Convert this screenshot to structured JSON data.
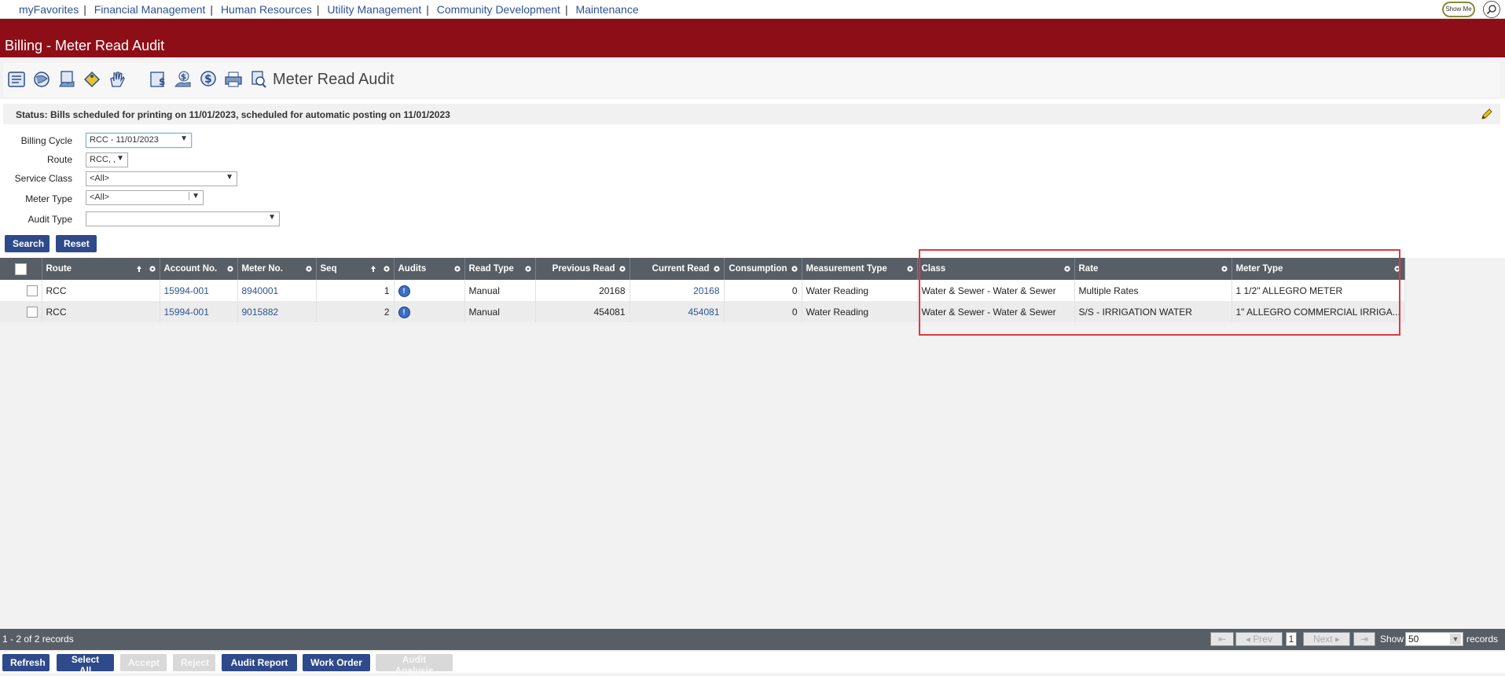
{
  "nav": {
    "links": [
      "myFavorites",
      "Financial Management",
      "Human Resources",
      "Utility Management",
      "Community Development",
      "Maintenance"
    ],
    "show_me": "Show Me"
  },
  "title": "Billing - Meter Read Audit",
  "toolbar": {
    "title": "Meter Read Audit",
    "icons": [
      "billing-list-icon",
      "globe-icon",
      "hand-doc-icon",
      "tag-icon",
      "hand-icon",
      "dollar-doc-icon",
      "dollar-hand-icon",
      "dollar-icon",
      "printer-icon",
      "search-doc-icon"
    ]
  },
  "status": {
    "text": "Status:  Bills scheduled for printing on 11/01/2023, scheduled for automatic posting on 11/01/2023"
  },
  "filters": {
    "billing_cycle_label": "Billing Cycle",
    "billing_cycle_value": "RCC - 11/01/2023",
    "route_label": "Route",
    "route_value": "RCC, ,",
    "service_class_label": "Service Class",
    "service_class_value": "<All>",
    "meter_type_label": "Meter Type",
    "meter_type_value": "<All>",
    "audit_type_label": "Audit Type",
    "audit_type_value": ""
  },
  "buttons": {
    "search": "Search",
    "reset": "Reset"
  },
  "grid": {
    "columns": [
      "Route",
      "Account No.",
      "Meter No.",
      "Seq",
      "Audits",
      "Read Type",
      "Previous Read",
      "Current Read",
      "Consumption",
      "Measurement Type",
      "Class",
      "Rate",
      "Meter Type"
    ],
    "rows": [
      [
        "RCC",
        "15994-001",
        "8940001",
        "1",
        "",
        "Manual",
        "20168",
        "20168",
        "0",
        "Water Reading",
        "Water & Sewer - Water & Sewer",
        "Multiple Rates",
        "1 1/2\" ALLEGRO METER"
      ],
      [
        "RCC",
        "15994-001",
        "9015882",
        "2",
        "",
        "Manual",
        "454081",
        "454081",
        "0",
        "Water Reading",
        "Water & Sewer - Water & Sewer",
        "S/S - IRRIGATION WATER",
        "1\" ALLEGRO COMMERCIAL IRRIGA..."
      ]
    ]
  },
  "footer": {
    "record_count": "1 - 2 of 2 records",
    "prev": "Prev",
    "next": "Next",
    "page": "1",
    "show_label": "Show",
    "show_value": "50",
    "records_label": "records"
  },
  "actions": {
    "refresh": "Refresh",
    "select_all": "Select All",
    "accept": "Accept",
    "reject": "Reject",
    "audit_report": "Audit Report",
    "work_order": "Work Order",
    "audit_analysis": "Audit Analysis"
  }
}
